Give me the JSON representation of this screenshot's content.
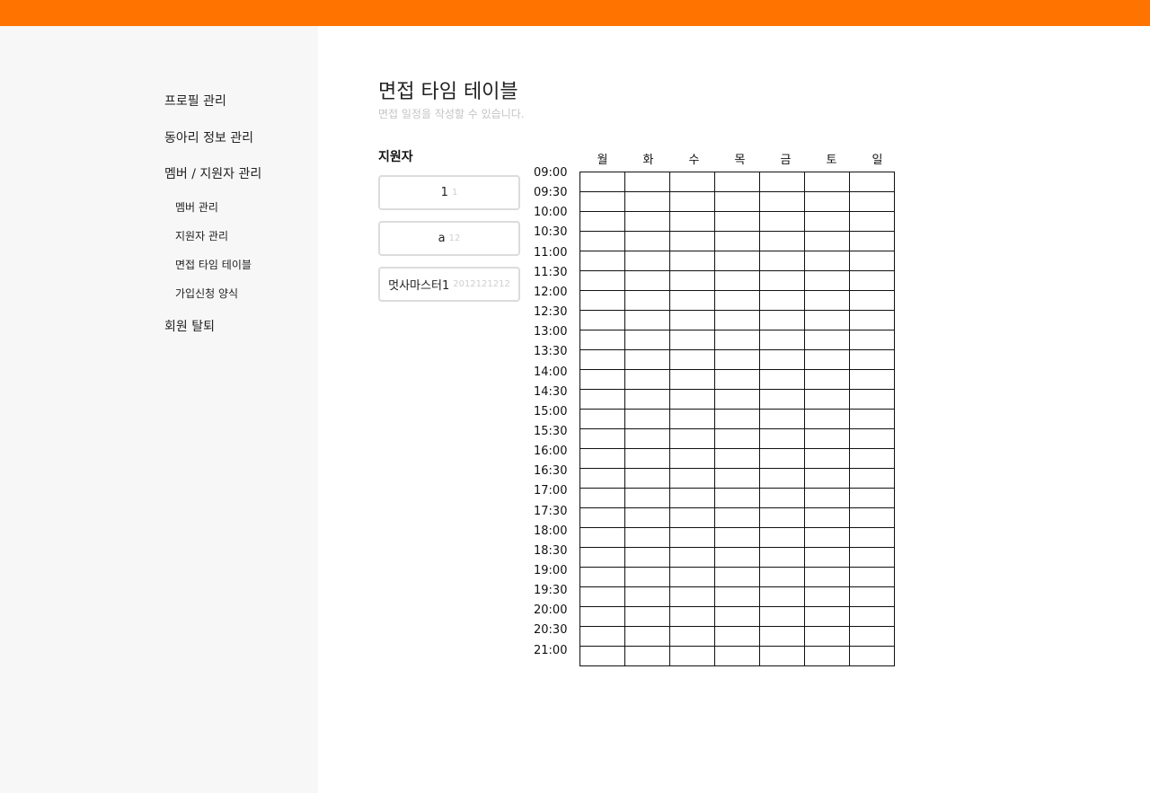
{
  "colors": {
    "topbar": "#ff7300",
    "sidebar_bg": "#f7f7f7"
  },
  "sidebar": {
    "items": [
      {
        "label": "프로필 관리"
      },
      {
        "label": "동아리 정보 관리"
      },
      {
        "label": "멤버 / 지원자 관리"
      }
    ],
    "subitems": [
      {
        "label": "멤버 관리"
      },
      {
        "label": "지원자 관리"
      },
      {
        "label": "면접 타임 테이블"
      },
      {
        "label": "가입신청 양식"
      }
    ],
    "bottom_item": {
      "label": "회원 탈퇴"
    }
  },
  "main": {
    "title": "면접 타임 테이블",
    "subtitle": "면접 일정을 작성할 수 있습니다.",
    "applicants_heading": "지원자",
    "applicants": [
      {
        "name": "1",
        "id": "1"
      },
      {
        "name": "a",
        "id": "12"
      },
      {
        "name": "멋사마스터1",
        "id": "2012121212"
      }
    ]
  },
  "timetable": {
    "days": [
      "월",
      "화",
      "수",
      "목",
      "금",
      "토",
      "일"
    ],
    "times": [
      "09:00",
      "09:30",
      "10:00",
      "10:30",
      "11:00",
      "11:30",
      "12:00",
      "12:30",
      "13:00",
      "13:30",
      "14:00",
      "14:30",
      "15:00",
      "15:30",
      "16:00",
      "16:30",
      "17:00",
      "17:30",
      "18:00",
      "18:30",
      "19:00",
      "19:30",
      "20:00",
      "20:30",
      "21:00"
    ],
    "row_count": 25
  }
}
